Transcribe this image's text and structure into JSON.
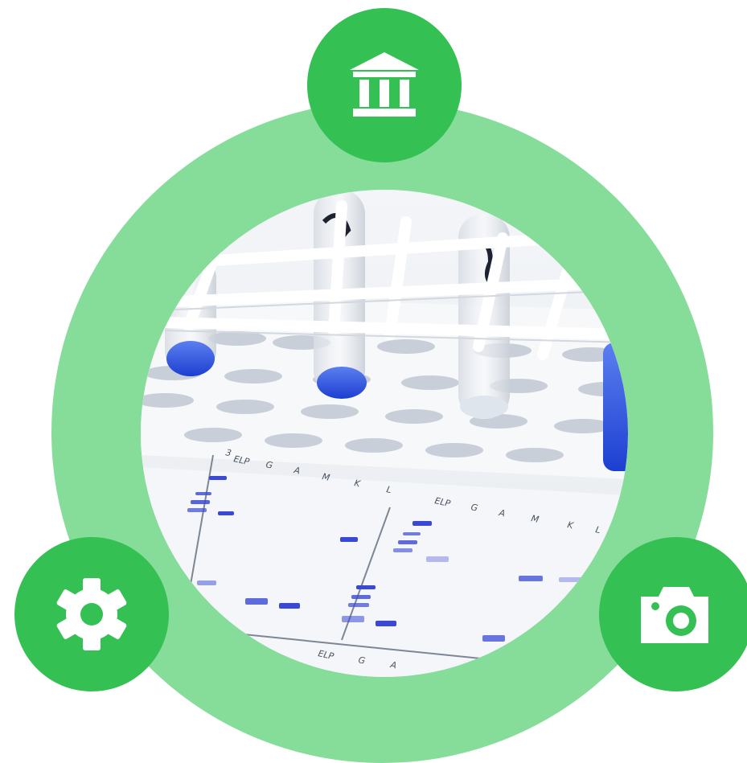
{
  "colors": {
    "ring": "#85dd99",
    "badge": "#34c052",
    "icon": "#ffffff"
  },
  "icons": {
    "top": "institution-icon",
    "left": "gear-icon",
    "right": "camera-icon"
  },
  "photo": {
    "subject": "test-tubes-and-electrophoresis-gel",
    "gel_labels": {
      "left_lanes": [
        "ELP",
        "G",
        "A",
        "M",
        "K",
        "L"
      ],
      "right_lanes": [
        "ELP",
        "G",
        "A",
        "M",
        "K",
        "L"
      ],
      "lane_number": "3",
      "bottom_lanes": [
        "ELP",
        "G",
        "A"
      ]
    }
  }
}
